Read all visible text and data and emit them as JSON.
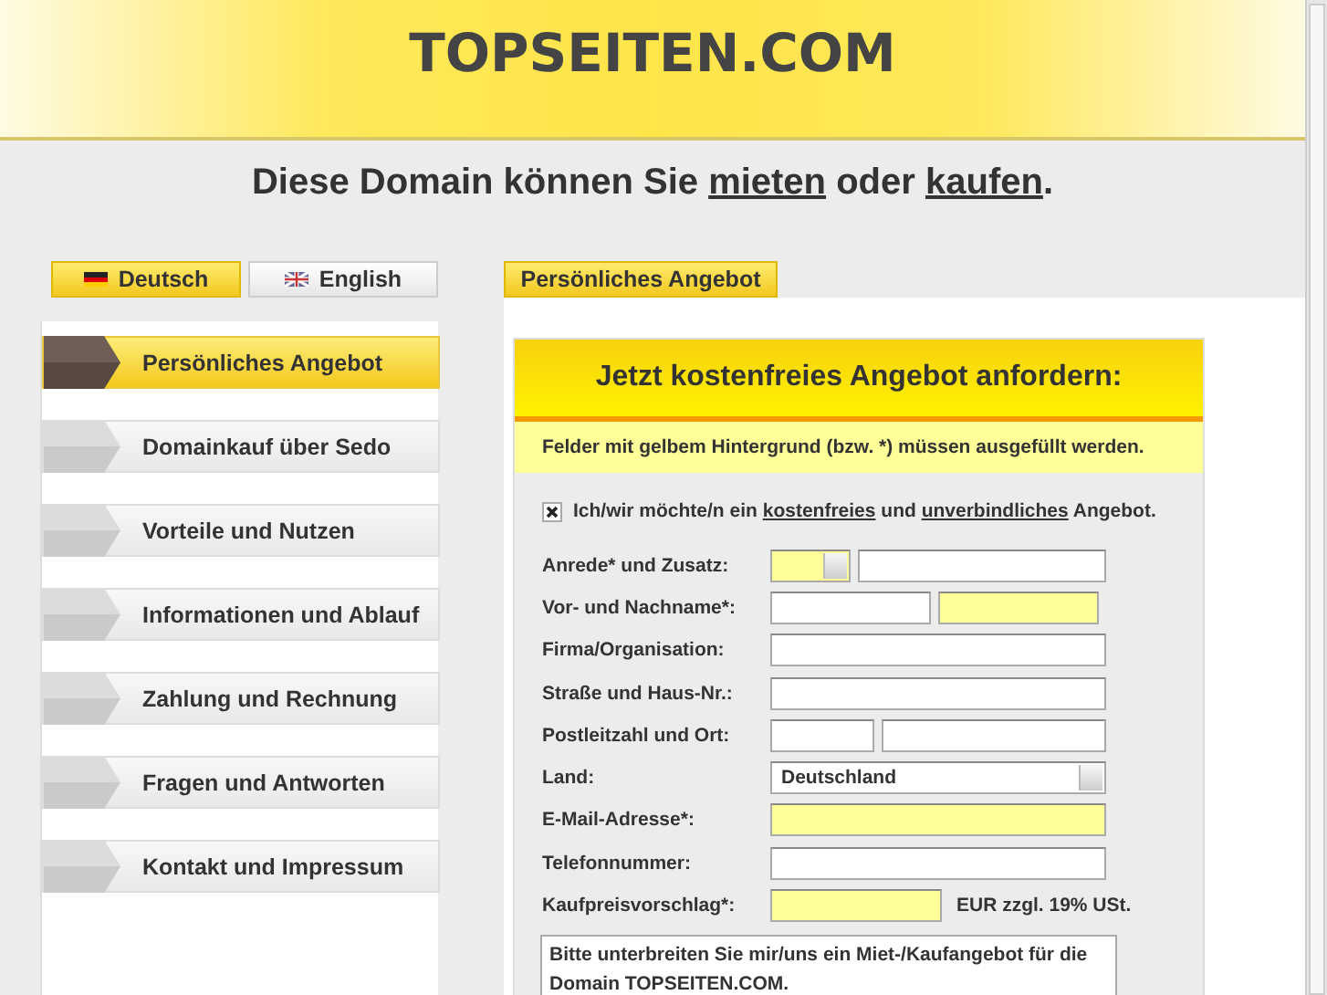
{
  "logo": "TOPSEITEN.COM",
  "headline": [
    {
      "kind": "text",
      "text": "Diese Domain können Sie "
    },
    {
      "kind": "link",
      "text": "mieten"
    },
    {
      "kind": "text",
      "text": " oder "
    },
    {
      "kind": "link",
      "text": "kaufen"
    },
    {
      "kind": "text",
      "text": "."
    }
  ],
  "language_tabs": [
    {
      "label": "Deutsch",
      "selected": true
    },
    {
      "label": "English",
      "selected": false
    }
  ],
  "content_tab": {
    "label": "Persönliches Angebot",
    "selected": true
  },
  "sidebar": {
    "items": [
      {
        "label": "Persönliches Angebot",
        "selected": true
      },
      {
        "label": "Domainkauf über Sedo",
        "selected": false
      },
      {
        "label": "Vorteile und Nutzen",
        "selected": false
      },
      {
        "label": "Informationen und Ablauf",
        "selected": false
      },
      {
        "label": "Zahlung und Rechnung",
        "selected": false
      },
      {
        "label": "Fragen und Antworten",
        "selected": false
      },
      {
        "label": "Kontakt und Impressum",
        "selected": false
      }
    ]
  },
  "form": {
    "title": "Jetzt kostenfreies Angebot anfordern:",
    "notice": "Felder mit gelbem Hintergrund (bzw. *) müssen ausgefüllt werden.",
    "consent": {
      "checked": true,
      "parts": [
        {
          "kind": "text",
          "text": "Ich/wir möchte/n ein "
        },
        {
          "kind": "link",
          "text": "kostenfreies"
        },
        {
          "kind": "text",
          "text": " und "
        },
        {
          "kind": "link",
          "text": "unverbindliches"
        },
        {
          "kind": "text",
          "text": " Angebot."
        }
      ]
    },
    "rows": [
      {
        "label": "Anrede* und Zusatz:",
        "fields": [
          {
            "kind": "select",
            "required": true
          },
          {
            "kind": "input",
            "required": false
          }
        ]
      },
      {
        "label": "Vor- und Nachname*:",
        "fields": [
          {
            "kind": "input",
            "required": false
          },
          {
            "kind": "input",
            "required": true
          }
        ]
      },
      {
        "label": "Firma/Organisation:",
        "fields": [
          {
            "kind": "input",
            "required": false
          }
        ]
      },
      {
        "label": "Straße und Haus-Nr.:",
        "fields": [
          {
            "kind": "input",
            "required": false
          }
        ]
      },
      {
        "label": "Postleitzahl und Ort:",
        "fields": [
          {
            "kind": "input",
            "required": false
          },
          {
            "kind": "input",
            "required": false
          }
        ]
      },
      {
        "label": "Land:",
        "fields": [
          {
            "kind": "select",
            "required": false,
            "value": "Deutschland"
          }
        ]
      },
      {
        "label": "E-Mail-Adresse*:",
        "fields": [
          {
            "kind": "input",
            "required": true
          }
        ]
      },
      {
        "label": "Telefonnummer:",
        "fields": [
          {
            "kind": "input",
            "required": false
          }
        ]
      },
      {
        "label": "Kaufpreisvorschlag*:",
        "fields": [
          {
            "kind": "input",
            "required": true
          }
        ],
        "suffix": "EUR zzgl. 19% USt."
      }
    ],
    "message": "Bitte unterbreiten Sie mir/uns ein Miet-/Kaufangebot für die Domain TOPSEITEN.COM."
  }
}
